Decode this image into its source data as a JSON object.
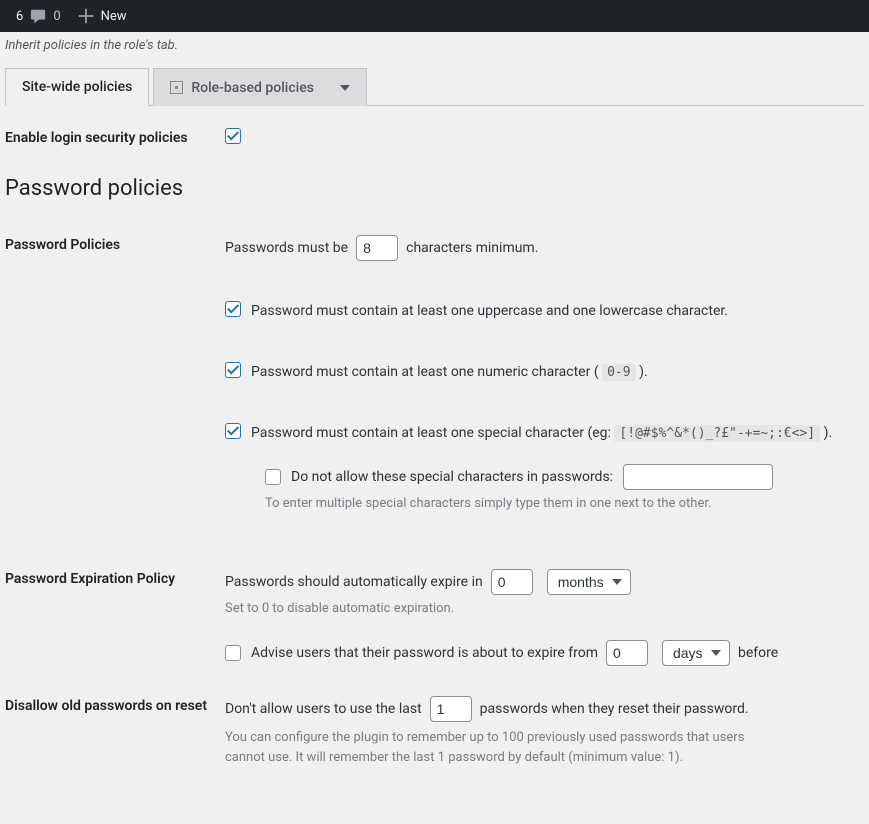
{
  "adminbar": {
    "comments": "6",
    "updates": "0",
    "new": "New"
  },
  "hint": "Inherit policies in the role's tab.",
  "tabs": {
    "sitewide": "Site-wide policies",
    "rolebased": "Role-based policies"
  },
  "rows": {
    "enable_label": "Enable login security policies",
    "policies_section": "Password policies",
    "policies_label": "Password Policies",
    "expiration_label": "Password Expiration Policy",
    "disallow_label": "Disallow old passwords on reset"
  },
  "policies": {
    "min_prefix": "Passwords must be",
    "min_value": "8",
    "min_suffix": "characters minimum.",
    "upper_lower": "Password must contain at least one uppercase and one lowercase character.",
    "numeric_prefix": "Password must contain at least one numeric character (",
    "numeric_code": "0-9",
    "numeric_suffix": ").",
    "special_prefix": "Password must contain at least one special character (eg:",
    "special_code": "[!@#$%^&*()_?£\"-+=~;:€<>]",
    "special_suffix": ").",
    "disallow_special": "Do not allow these special characters in passwords:",
    "disallow_help": "To enter multiple special characters simply type them in one next to the other."
  },
  "expiration": {
    "prefix": "Passwords should automatically expire in",
    "value": "0",
    "unit": "months",
    "help": "Set to 0 to disable automatic expiration.",
    "advise_prefix": "Advise users that their password is about to expire from",
    "advise_value": "0",
    "advise_unit": "days",
    "advise_suffix": "before"
  },
  "disallow": {
    "prefix": "Don't allow users to use the last",
    "value": "1",
    "suffix": "passwords when they reset their password.",
    "help": "You can configure the plugin to remember up to 100 previously used passwords that users cannot use. It will remember the last 1 password by default (minimum value: 1)."
  }
}
